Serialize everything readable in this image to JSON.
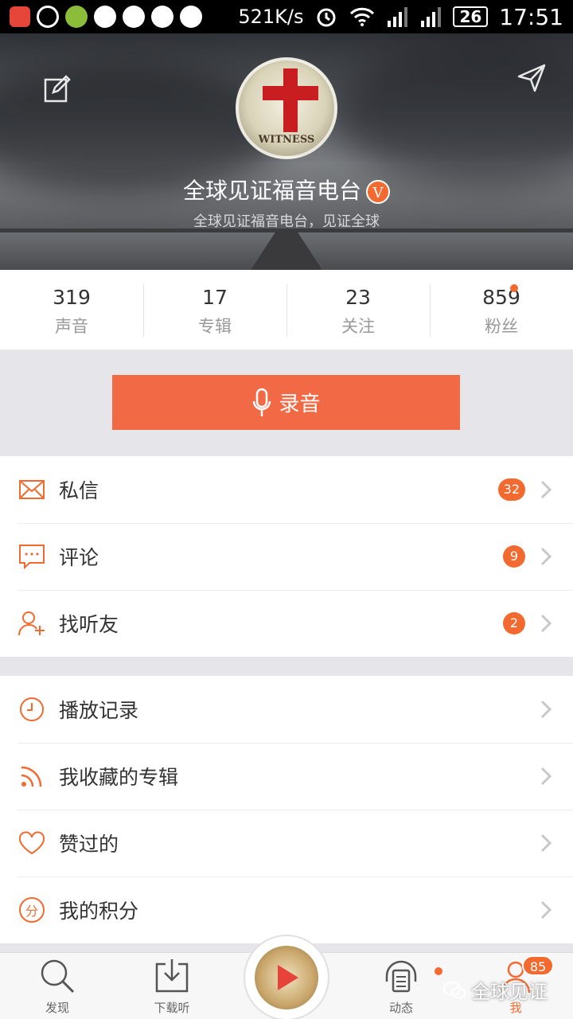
{
  "status_bar": {
    "speed": "521K/s",
    "battery": "26",
    "time": "17:51"
  },
  "profile": {
    "name": "全球见证福音电台",
    "verified_badge": "V",
    "subtitle": "全球见证福音电台，见证全球",
    "avatar_text": "WITNESS"
  },
  "stats": [
    {
      "value": "319",
      "label": "声音"
    },
    {
      "value": "17",
      "label": "专辑"
    },
    {
      "value": "23",
      "label": "关注"
    },
    {
      "value": "859",
      "label": "粉丝"
    }
  ],
  "record_button": {
    "label": "录音"
  },
  "group1": [
    {
      "label": "私信",
      "badge": "32",
      "icon": "mail-icon"
    },
    {
      "label": "评论",
      "badge": "9",
      "icon": "comment-icon"
    },
    {
      "label": "找听友",
      "badge": "2",
      "icon": "add-friend-icon"
    }
  ],
  "group2": [
    {
      "label": "播放记录",
      "icon": "clock-icon"
    },
    {
      "label": "我收藏的专辑",
      "icon": "rss-icon"
    },
    {
      "label": "赞过的",
      "icon": "heart-icon"
    },
    {
      "label": "我的积分",
      "icon": "points-icon",
      "icon_char": "分"
    }
  ],
  "tabs": [
    {
      "label": "发现",
      "icon": "search-icon"
    },
    {
      "label": "下载听",
      "icon": "download-icon"
    },
    {
      "label": "动态",
      "icon": "headphones-icon"
    },
    {
      "label": "我",
      "icon": "person-icon",
      "badge": "85"
    }
  ],
  "watermark": "全球见证",
  "colors": {
    "accent": "#f26a2f",
    "record": "#f26a45"
  }
}
